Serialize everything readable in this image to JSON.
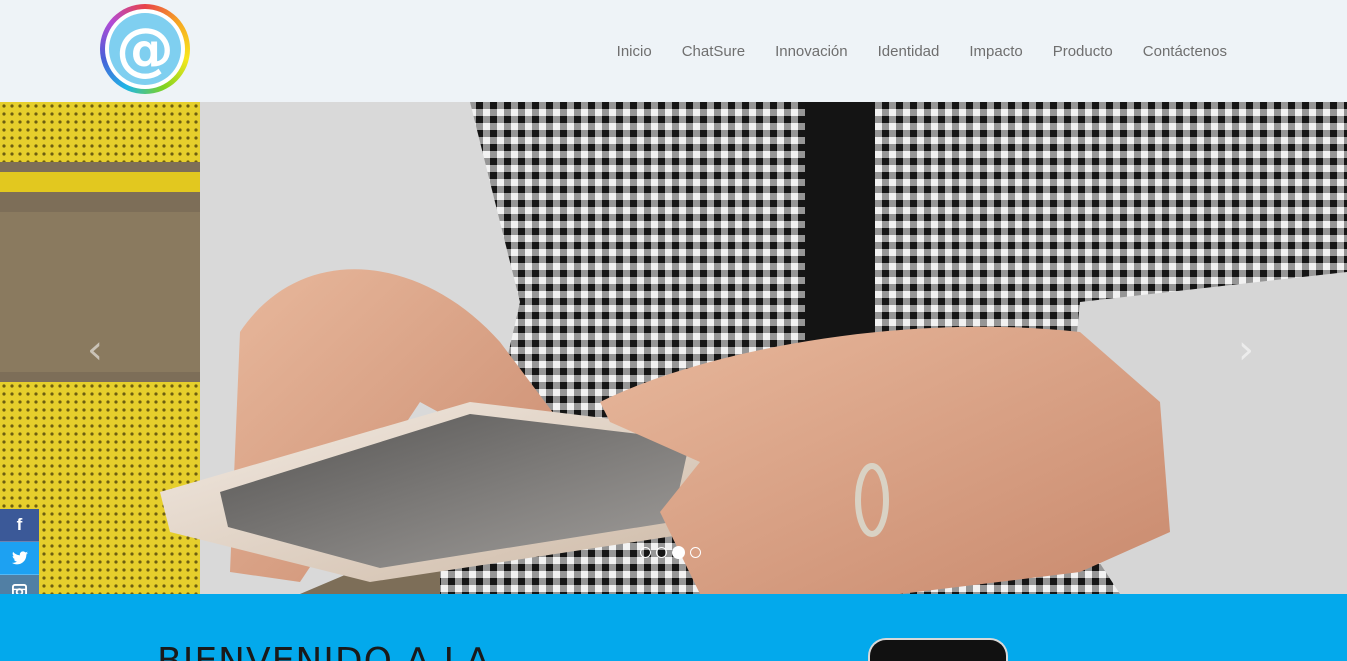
{
  "header": {
    "logo_glyph": "@",
    "nav": [
      {
        "label": "Inicio"
      },
      {
        "label": "ChatSure"
      },
      {
        "label": "Innovación"
      },
      {
        "label": "Identidad"
      },
      {
        "label": "Impacto"
      },
      {
        "label": "Producto"
      },
      {
        "label": "Contáctenos"
      }
    ]
  },
  "carousel": {
    "prev_glyph": "‹",
    "next_glyph": "›",
    "slide_count": 4,
    "active_index": 2
  },
  "social": {
    "facebook_glyph": "f",
    "twitter_icon": "twitter-icon",
    "instagram_icon": "instagram-icon"
  },
  "welcome": {
    "title": "BIENVENIDO A LA"
  },
  "colors": {
    "header_bg": "#eef3f7",
    "accent_blue": "#03a9ec",
    "nav_text": "#6f6f6f",
    "facebook": "#3b5998",
    "twitter": "#1da1f2",
    "instagram": "#517fa4"
  }
}
